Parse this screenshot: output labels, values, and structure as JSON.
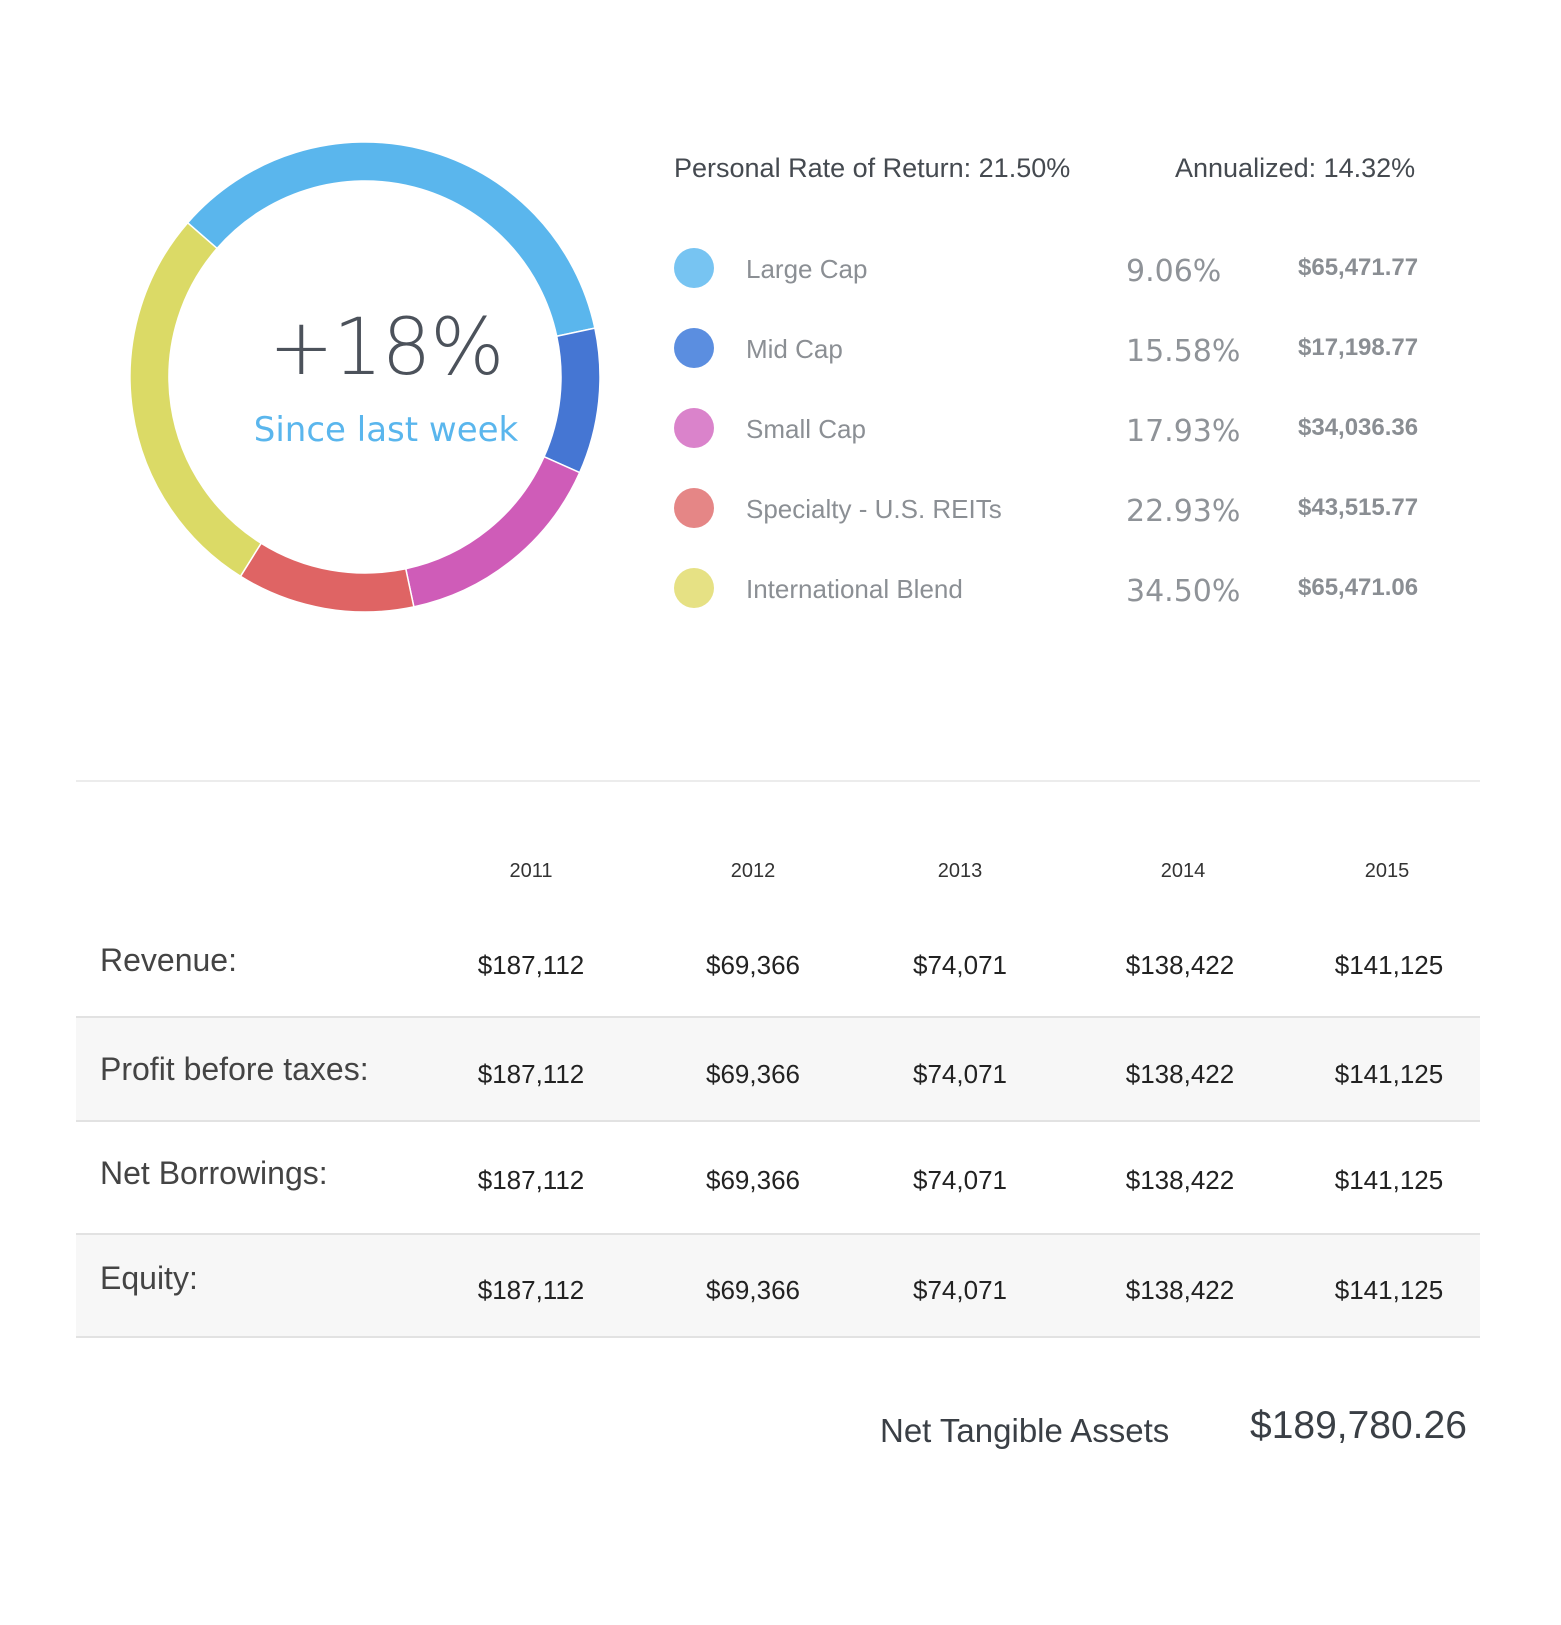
{
  "performance": {
    "change": "+18%",
    "period": "Since last week"
  },
  "allocation_chart": {
    "type": "pie",
    "start_angle": -49,
    "segments": [
      {
        "name": "Large Cap",
        "value": 127,
        "color": "#5ab6ed"
      },
      {
        "name": "Mid Cap",
        "value": 36,
        "color": "#4576d3"
      },
      {
        "name": "Small Cap",
        "value": 54,
        "color": "#cf5cb8"
      },
      {
        "name": "Specialty - U.S. REITs",
        "value": 44,
        "color": "#df6464"
      },
      {
        "name": "International Blend",
        "value": 99,
        "color": "#dbda66"
      }
    ]
  },
  "returns": {
    "personal_rate": "Personal Rate of Return: 21.50%",
    "annualized": "Annualized: 14.32%"
  },
  "legend": [
    {
      "name": "Large Cap",
      "pct": "9.06%",
      "amount": "$65,471.77",
      "color": "#77c4f2"
    },
    {
      "name": "Mid Cap",
      "pct": "15.58%",
      "amount": "$17,198.77",
      "color": "#5b8ee0"
    },
    {
      "name": "Small Cap",
      "pct": "17.93%",
      "amount": "$34,036.36",
      "color": "#da83cb"
    },
    {
      "name": "Specialty - U.S. REITs",
      "pct": "22.93%",
      "amount": "$43,515.77",
      "color": "#e58686"
    },
    {
      "name": "International Blend",
      "pct": "34.50%",
      "amount": "$65,471.06",
      "color": "#e6e184"
    }
  ],
  "financials": {
    "years": [
      "2011",
      "2012",
      "2013",
      "2014",
      "2015"
    ],
    "rows": [
      {
        "label": "Revenue:",
        "values": [
          "$187,112",
          "$69,366",
          "$74,071",
          "$138,422",
          "$141,125"
        ]
      },
      {
        "label": "Profit before taxes:",
        "values": [
          "$187,112",
          "$69,366",
          "$74,071",
          "$138,422",
          "$141,125"
        ]
      },
      {
        "label": "Net Borrowings:",
        "values": [
          "$187,112",
          "$69,366",
          "$74,071",
          "$138,422",
          "$141,125"
        ]
      },
      {
        "label": "Equity:",
        "values": [
          "$187,112",
          "$69,366",
          "$74,071",
          "$138,422",
          "$141,125"
        ]
      }
    ]
  },
  "net_tangible_assets": {
    "label": "Net Tangible Assets",
    "value": "$189,780.26"
  }
}
